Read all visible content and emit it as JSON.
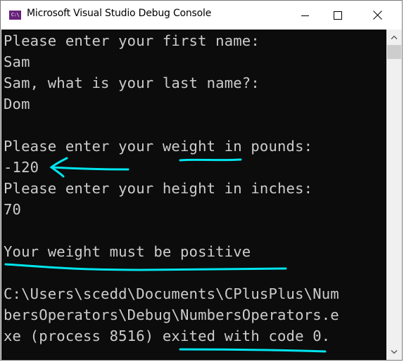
{
  "window": {
    "title": "Microsoft Visual Studio Debug Console",
    "icon_label": "C:\\",
    "icon_name": "console-app-icon",
    "buttons": {
      "minimize": "minimize",
      "maximize": "maximize",
      "close": "close"
    }
  },
  "console": {
    "lines": [
      "Please enter your first name:",
      "Sam",
      "Sam, what is your last name?:",
      "Dom",
      "",
      "Please enter your weight in pounds:",
      "-120",
      "Please enter your height in inches:",
      "70",
      "",
      "Your weight must be positive",
      "",
      "C:\\Users\\scedd\\Documents\\CPlusPlus\\Num",
      "bersOperators\\Debug\\NumbersOperators.e",
      "xe (process 8516) exited with code 0."
    ],
    "text_color": "#cccccc",
    "background": "#0c0c0c"
  },
  "annotations": {
    "color": "#00e5ee",
    "items": [
      "underline: weight",
      "arrow: -120",
      "underline: Your weight must be positive",
      "underline: exited with code 0."
    ]
  }
}
